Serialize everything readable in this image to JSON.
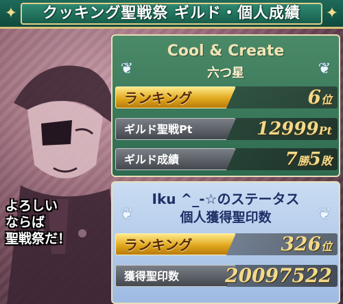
{
  "title": "クッキング聖戦祭 ギルド・個人成績",
  "guild": {
    "name": "Cool & Create",
    "rank_label": "六つ星",
    "ranking_label": "ランキング",
    "ranking_value": "6",
    "ranking_unit": "位",
    "pt_label": "ギルド聖戦Pt",
    "pt_value": "12999",
    "pt_unit": "Pt",
    "record_label": "ギルド成績",
    "wins": "7",
    "wins_unit": "勝",
    "losses": "5",
    "losses_unit": "敗"
  },
  "personal": {
    "name": "Iku ^_-☆のステータス",
    "subtitle": "個人獲得聖印数",
    "ranking_label": "ランキング",
    "ranking_value": "326",
    "ranking_unit": "位",
    "seals_label": "獲得聖印数",
    "seals_value": "20097522"
  },
  "speech": {
    "line1": "よろしい",
    "line2": "ならば",
    "line3": "聖戦祭だ！"
  },
  "icons": {
    "corner": "✦",
    "wing": "❦"
  },
  "colors": {
    "gold_text": "#f2d98a",
    "guild_panel": "#2d6a50",
    "personal_panel": "#9fbbe3"
  }
}
